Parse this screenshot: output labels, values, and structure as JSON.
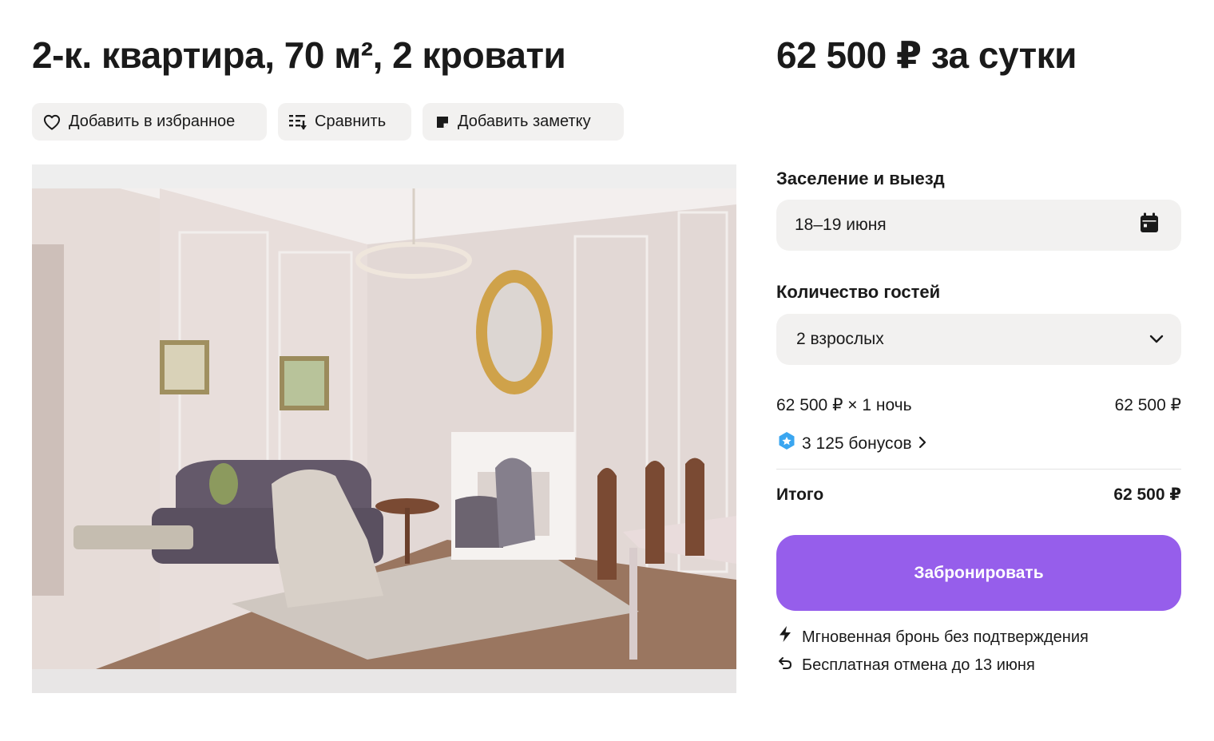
{
  "header": {
    "title": "2-к. квартира, 70 м², 2 кровати",
    "price": "62 500 ₽ за сутки"
  },
  "actions": {
    "favorite_label": "Добавить в избранное",
    "compare_label": "Сравнить",
    "note_label": "Добавить заметку"
  },
  "booking": {
    "dates_label": "Заселение и выезд",
    "dates_value": "18–19 июня",
    "guests_label": "Количество гостей",
    "guests_value": "2 взрослых",
    "calc_label": "62 500 ₽ × 1 ночь",
    "calc_value": "62 500 ₽",
    "bonus_label": "3 125 бонусов",
    "total_label": "Итого",
    "total_value": "62 500 ₽",
    "book_button": "Забронировать",
    "feature_instant": "Мгновенная бронь без подтверждения",
    "feature_cancel": "Бесплатная отмена до 13 июня"
  },
  "colors": {
    "accent": "#965eeb",
    "bonus_icon": "#3aa6f0",
    "field_bg": "#f2f1f0"
  },
  "icons": {
    "favorite": "heart-icon",
    "compare": "compare-list-icon",
    "note": "note-icon",
    "dates": "calendar-icon",
    "guests": "chevron-down-icon",
    "bonus": "bonus-badge-icon",
    "bonus_more": "chevron-right-icon",
    "instant": "lightning-icon",
    "cancel": "undo-arrow-icon"
  }
}
